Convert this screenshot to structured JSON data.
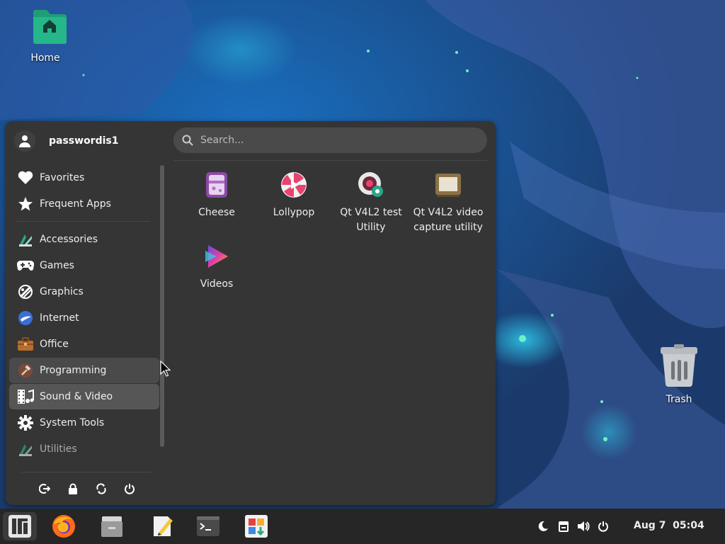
{
  "desktop": {
    "home_label": "Home",
    "trash_label": "Trash"
  },
  "menu": {
    "username": "passwordis1",
    "search_placeholder": "Search...",
    "categories": [
      {
        "label": "Favorites",
        "icon": "heart-icon"
      },
      {
        "label": "Frequent Apps",
        "icon": "star-icon"
      },
      {
        "label": "Accessories",
        "icon": "accessories-icon"
      },
      {
        "label": "Games",
        "icon": "gamepad-icon"
      },
      {
        "label": "Graphics",
        "icon": "graphics-icon"
      },
      {
        "label": "Internet",
        "icon": "internet-icon"
      },
      {
        "label": "Office",
        "icon": "briefcase-icon"
      },
      {
        "label": "Programming",
        "icon": "hammer-icon"
      },
      {
        "label": "Sound & Video",
        "icon": "film-music-icon"
      },
      {
        "label": "System Tools",
        "icon": "gear-icon"
      },
      {
        "label": "Utilities",
        "icon": "utilities-icon"
      }
    ],
    "hovered_category": "Programming",
    "selected_category": "Sound & Video",
    "apps": [
      {
        "label": "Cheese",
        "icon": "cheese-icon"
      },
      {
        "label": "Lollypop",
        "icon": "lollypop-icon"
      },
      {
        "label": "Qt V4L2 test Utility",
        "line1": "Qt V4L2 test",
        "line2": "Utility",
        "icon": "webcam-icon"
      },
      {
        "label": "Qt V4L2 video capture utility",
        "line1": "Qt V4L2 video",
        "line2": "capture utility",
        "icon": "video-capture-icon"
      },
      {
        "label": "Videos",
        "icon": "videos-icon"
      }
    ],
    "session_buttons": [
      "logout-icon",
      "lock-icon",
      "switch-user-icon",
      "power-icon"
    ]
  },
  "taskbar": {
    "apps": [
      "menu-icon",
      "firefox-icon",
      "file-manager-icon",
      "text-editor-icon",
      "terminal-icon",
      "software-store-icon"
    ],
    "tray": [
      "night-mode-icon",
      "clipboard-icon",
      "volume-icon",
      "power-icon"
    ],
    "clock": "Aug 7  05:04"
  },
  "colors": {
    "menu_bg": "#353535",
    "taskbar_bg": "#262626",
    "accent_green": "#1f9e76",
    "wallpaper_blue": "#2b5aa0"
  }
}
